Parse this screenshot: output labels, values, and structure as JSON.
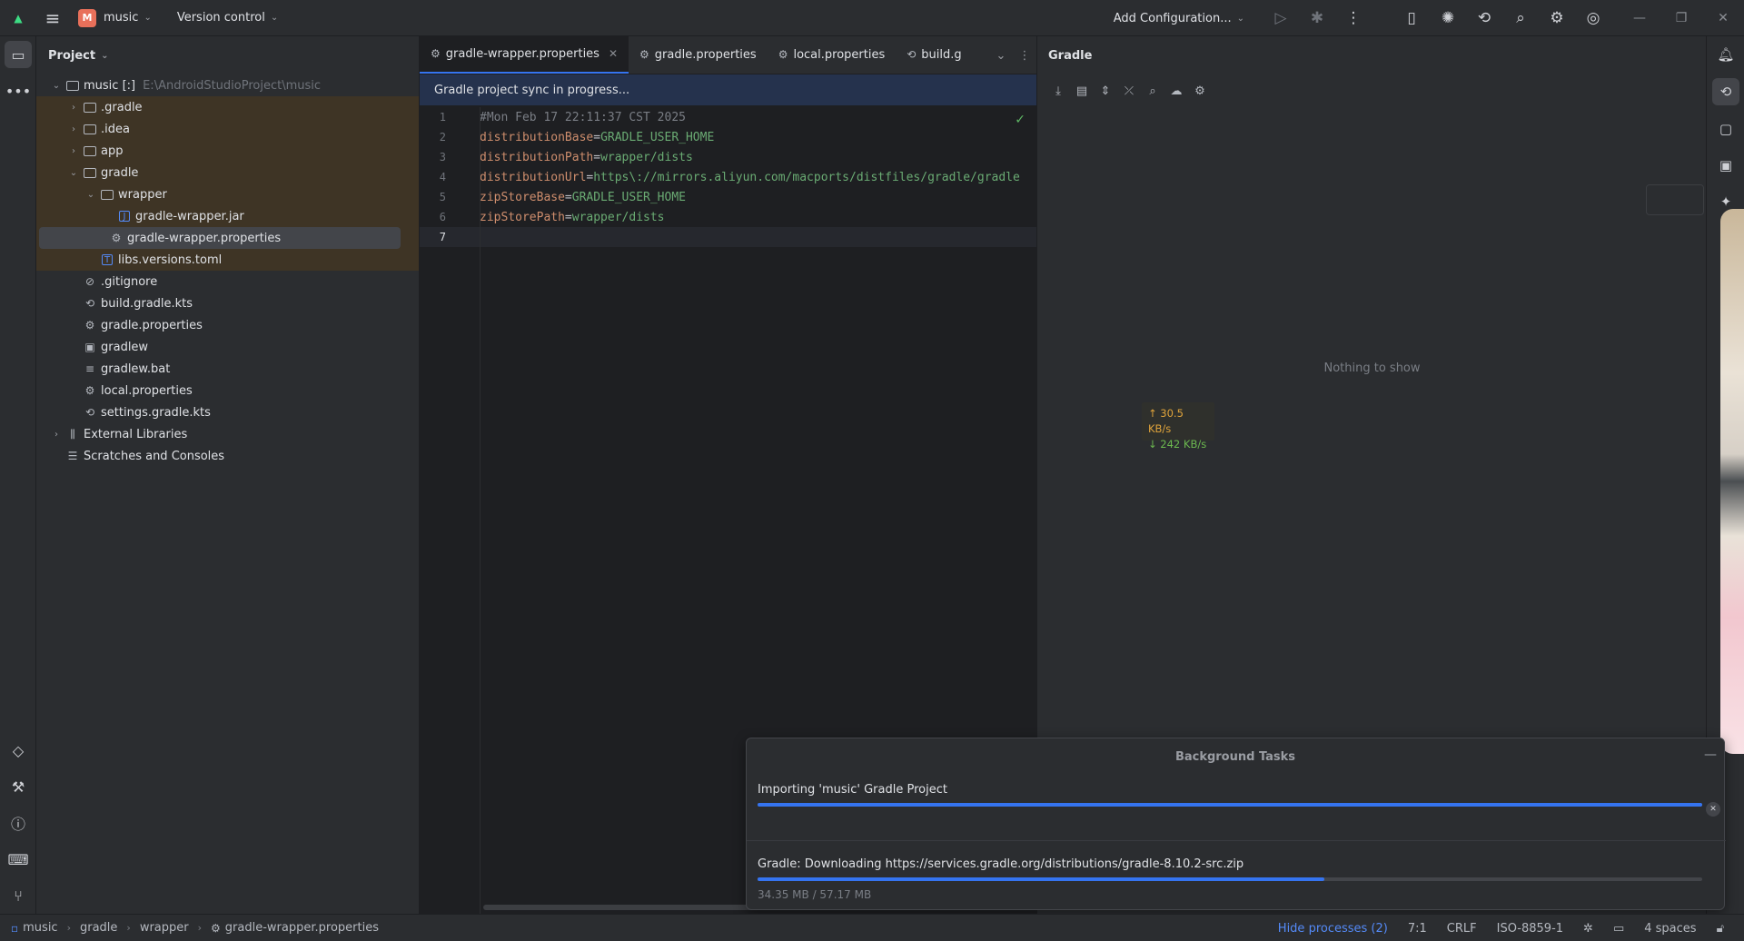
{
  "titlebar": {
    "project_badge": "M",
    "project_name": "music",
    "version_control": "Version control",
    "add_configuration": "Add Configuration..."
  },
  "project_panel": {
    "title": "Project",
    "tree": [
      {
        "label": "music [:]",
        "hint": "E:\\AndroidStudioProject\\music",
        "depth": 0,
        "arrow": "down",
        "icon": "folder"
      },
      {
        "label": ".gradle",
        "depth": 1,
        "arrow": "right",
        "icon": "folder"
      },
      {
        "label": ".idea",
        "depth": 1,
        "arrow": "right",
        "icon": "folder"
      },
      {
        "label": "app",
        "depth": 1,
        "arrow": "right",
        "icon": "folder"
      },
      {
        "label": "gradle",
        "depth": 1,
        "arrow": "down",
        "icon": "folder"
      },
      {
        "label": "wrapper",
        "depth": 2,
        "arrow": "down",
        "icon": "folder"
      },
      {
        "label": "gradle-wrapper.jar",
        "depth": 3,
        "icon": "jar"
      },
      {
        "label": "gradle-wrapper.properties",
        "depth": 3,
        "icon": "gear",
        "selected": true
      },
      {
        "label": "libs.versions.toml",
        "depth": 2,
        "icon": "toml"
      },
      {
        "label": ".gitignore",
        "depth": 1,
        "icon": "ignore"
      },
      {
        "label": "build.gradle.kts",
        "depth": 1,
        "icon": "gradle"
      },
      {
        "label": "gradle.properties",
        "depth": 1,
        "icon": "gear"
      },
      {
        "label": "gradlew",
        "depth": 1,
        "icon": "terminal"
      },
      {
        "label": "gradlew.bat",
        "depth": 1,
        "icon": "lines"
      },
      {
        "label": "local.properties",
        "depth": 1,
        "icon": "gear"
      },
      {
        "label": "settings.gradle.kts",
        "depth": 1,
        "icon": "gradle"
      },
      {
        "label": "External Libraries",
        "depth": 0,
        "arrow": "right",
        "icon": "library"
      },
      {
        "label": "Scratches and Consoles",
        "depth": 0,
        "icon": "scratch"
      }
    ]
  },
  "editor": {
    "tabs": [
      {
        "label": "gradle-wrapper.properties",
        "active": true
      },
      {
        "label": "gradle.properties"
      },
      {
        "label": "local.properties"
      },
      {
        "label": "build.g"
      }
    ],
    "sync_message": "Gradle project sync in progress...",
    "lines": [
      {
        "n": "1",
        "comment": "#Mon Feb 17 22:11:37 CST 2025"
      },
      {
        "n": "2",
        "key": "distributionBase",
        "value": "GRADLE_USER_HOME"
      },
      {
        "n": "3",
        "key": "distributionPath",
        "value": "wrapper/dists"
      },
      {
        "n": "4",
        "key": "distributionUrl",
        "value": "https\\://mirrors.aliyun.com/macports/distfiles/gradle/gradle"
      },
      {
        "n": "5",
        "key": "zipStoreBase",
        "value": "GRADLE_USER_HOME"
      },
      {
        "n": "6",
        "key": "zipStorePath",
        "value": "wrapper/dists"
      },
      {
        "n": "7"
      }
    ]
  },
  "gradle_panel": {
    "title": "Gradle",
    "empty_text": "Nothing to show"
  },
  "speed_widget": {
    "upload": "↑ 30.5 KB/s",
    "download": "↓ 242 KB/s"
  },
  "background_tasks": {
    "title": "Background Tasks",
    "tasks": [
      {
        "label": "Importing 'music' Gradle Project",
        "progress": 1.0
      },
      {
        "label": "Gradle: Downloading https://services.gradle.org/distributions/gradle-8.10.2-src.zip",
        "progress": 0.6,
        "detail": "34.35 MB / 57.17 MB"
      }
    ]
  },
  "statusbar": {
    "breadcrumbs": [
      "music",
      "gradle",
      "wrapper",
      "gradle-wrapper.properties"
    ],
    "hide_processes": "Hide processes (2)",
    "position": "7:1",
    "line_ending": "CRLF",
    "encoding": "ISO-8859-1",
    "indent": "4 spaces"
  },
  "colors": {
    "accent": "#3574f0",
    "highlight_row": "#3e3425",
    "background": "#1e1f22",
    "panel": "#2b2d30"
  }
}
